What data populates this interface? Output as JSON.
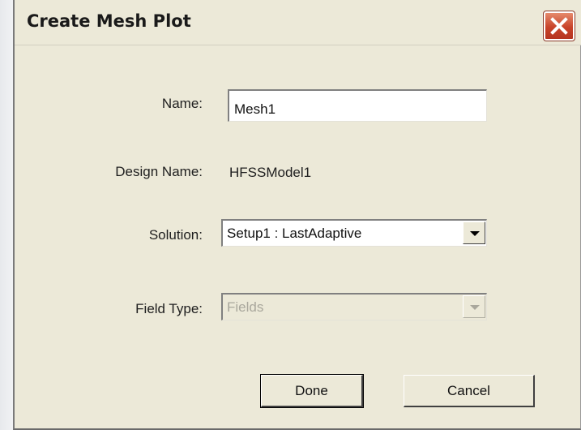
{
  "window": {
    "title": "Create Mesh Plot"
  },
  "form": {
    "name_label": "Name:",
    "name_value": "Mesh1",
    "design_label": "Design Name:",
    "design_value": "HFSSModel1",
    "solution_label": "Solution:",
    "solution_value": "Setup1 : LastAdaptive",
    "field_type_label": "Field Type:",
    "field_type_value": "Fields"
  },
  "buttons": {
    "done": "Done",
    "cancel": "Cancel"
  },
  "colors": {
    "dialog_bg": "#ece9d8",
    "close_red": "#c8432a"
  }
}
